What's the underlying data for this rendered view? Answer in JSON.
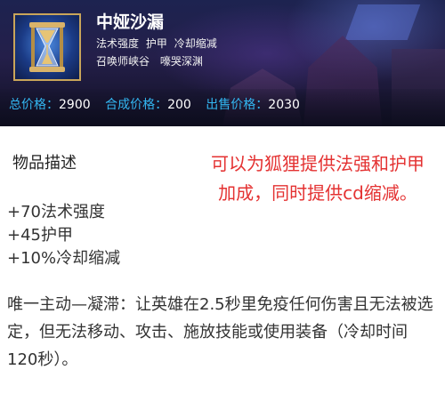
{
  "item": {
    "name": "中娅沙漏",
    "tags": [
      "法术强度",
      "护甲",
      "冷却缩减"
    ],
    "maps": [
      "召唤师峡谷",
      "嚎哭深渊"
    ],
    "prices": [
      {
        "label": "总价格：",
        "value": "2900"
      },
      {
        "label": "合成价格：",
        "value": "200"
      },
      {
        "label": "出售价格：",
        "value": "2030"
      }
    ]
  },
  "description": {
    "title": "物品描述",
    "stats": [
      "+70法术强度",
      "+45护甲",
      "+10%冷却缩减"
    ],
    "active": "唯一主动—凝滞：让英雄在2.5秒里免疫任何伤害且无法被选定，但无法移动、攻击、施放技能或使用装备（冷却时间120秒）。"
  },
  "annotation": {
    "lines": [
      "可以为狐狸提供法强和护甲",
      "加成，同时提供cd缩减。"
    ]
  },
  "colors": {
    "price_label": "#33b7f2",
    "annotation": "#e43232",
    "icon_border": "#c9a55a"
  },
  "icons": {
    "item_icon": "hourglass-icon"
  }
}
